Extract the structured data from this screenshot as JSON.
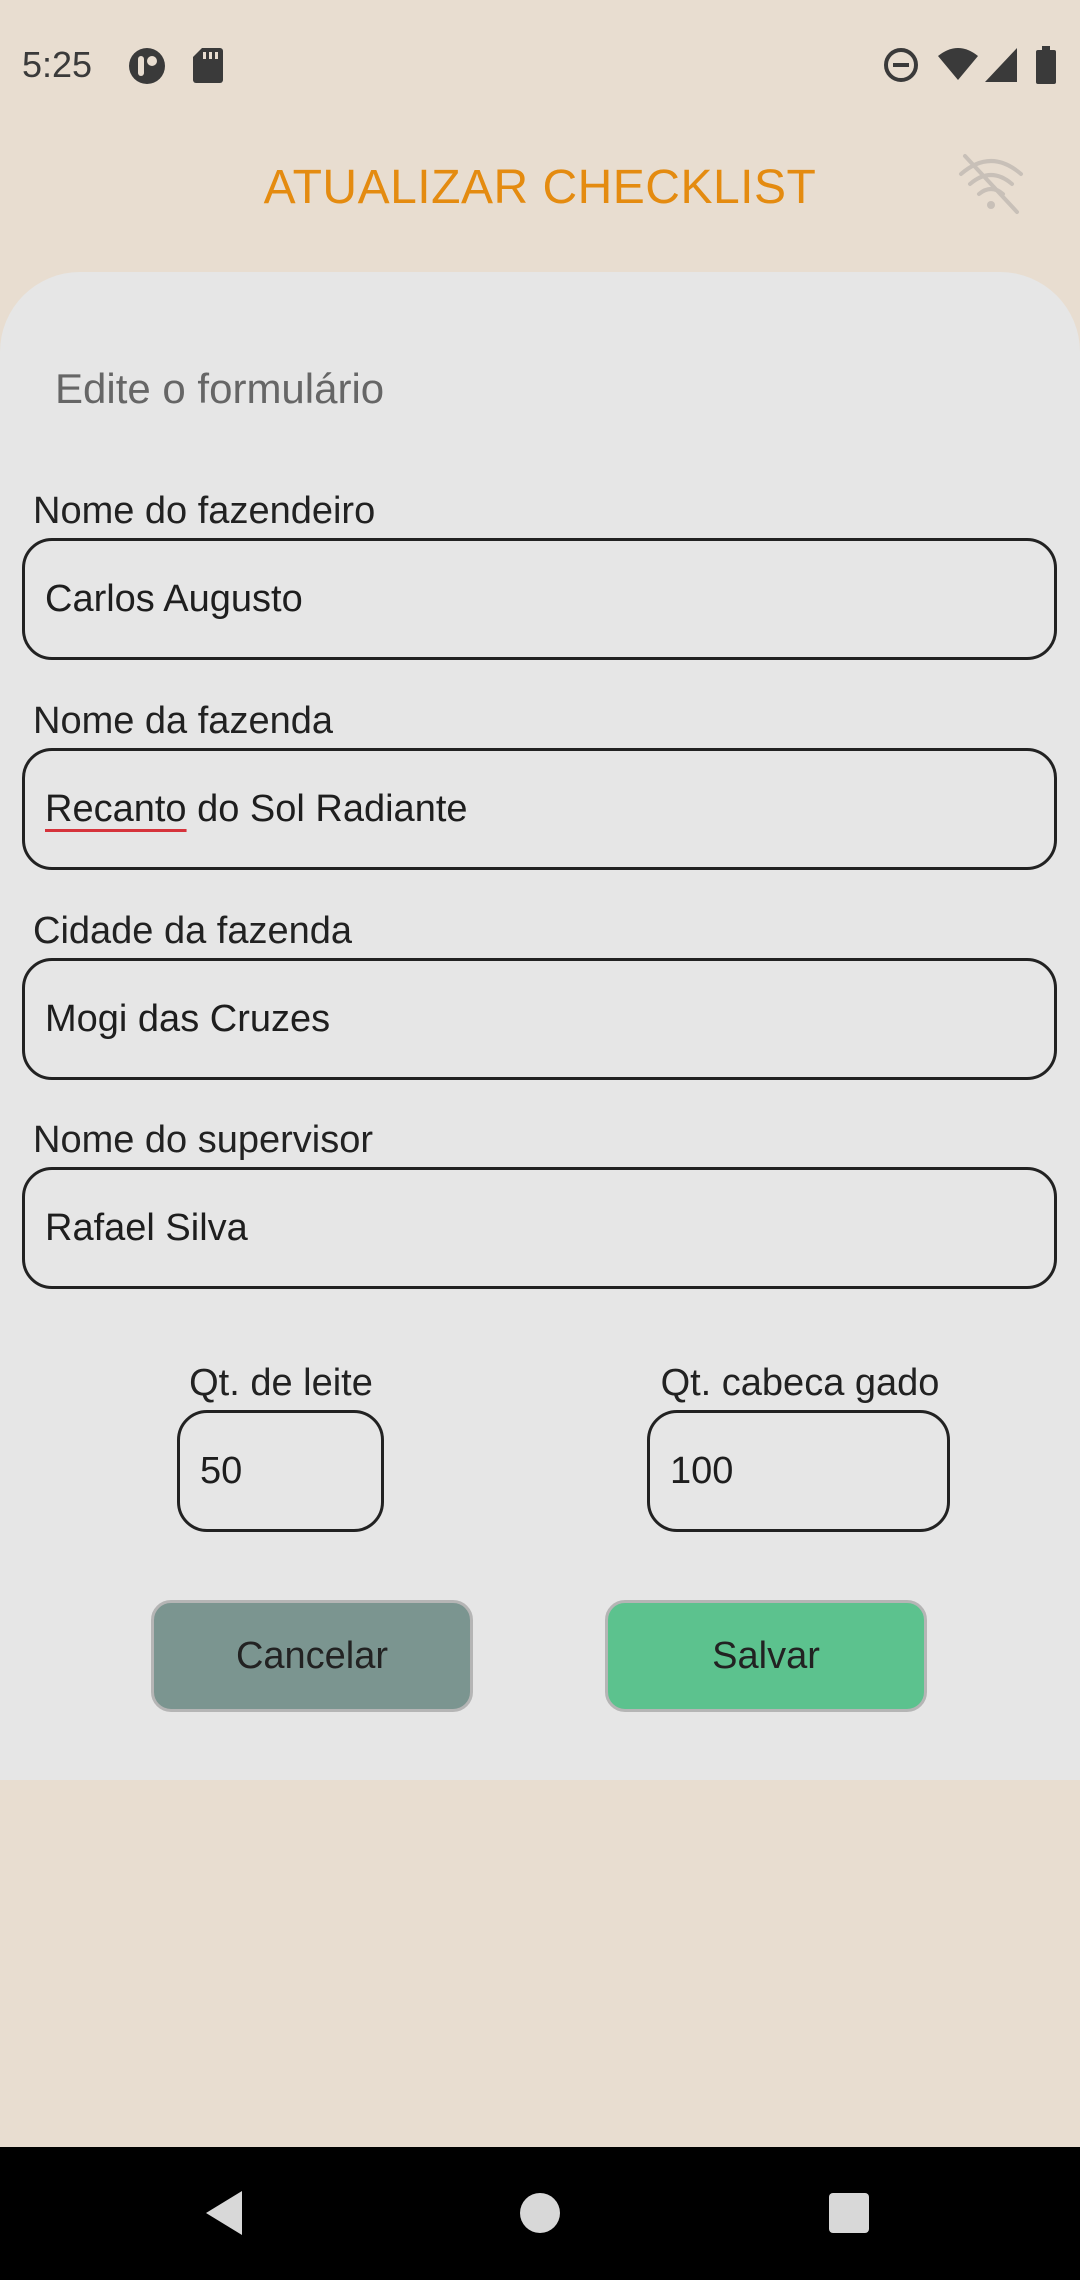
{
  "status_bar": {
    "time": "5:25",
    "icons_left": [
      "app-notification-icon",
      "sd-card-icon"
    ],
    "icons_right": [
      "do-not-disturb-icon",
      "wifi-icon",
      "cellular-signal-icon",
      "battery-icon"
    ]
  },
  "header": {
    "title": "ATUALIZAR CHECKLIST",
    "title_color": "#e48b10",
    "status_icon": "wifi-off-icon"
  },
  "form": {
    "heading": "Edite o formulário",
    "fields": [
      {
        "label": "Nome do fazendeiro",
        "value": "Carlos Augusto"
      },
      {
        "label": "Nome da fazenda",
        "value_underlined": "Recanto",
        "value_rest": " do Sol Radiante"
      },
      {
        "label": "Cidade da fazenda",
        "value": "Mogi das Cruzes"
      },
      {
        "label": "Nome do supervisor",
        "value": "Rafael Silva"
      }
    ],
    "milk": {
      "label": "Qt. de leite",
      "value": "50"
    },
    "cattle": {
      "label": "Qt. cabeca gado",
      "value": "100"
    }
  },
  "buttons": {
    "cancel": "Cancelar",
    "save": "Salvar",
    "cancel_color": "#7b9590",
    "save_color": "#5cc28e"
  },
  "nav": {
    "icons": [
      "back-icon",
      "home-icon",
      "recents-icon"
    ]
  }
}
